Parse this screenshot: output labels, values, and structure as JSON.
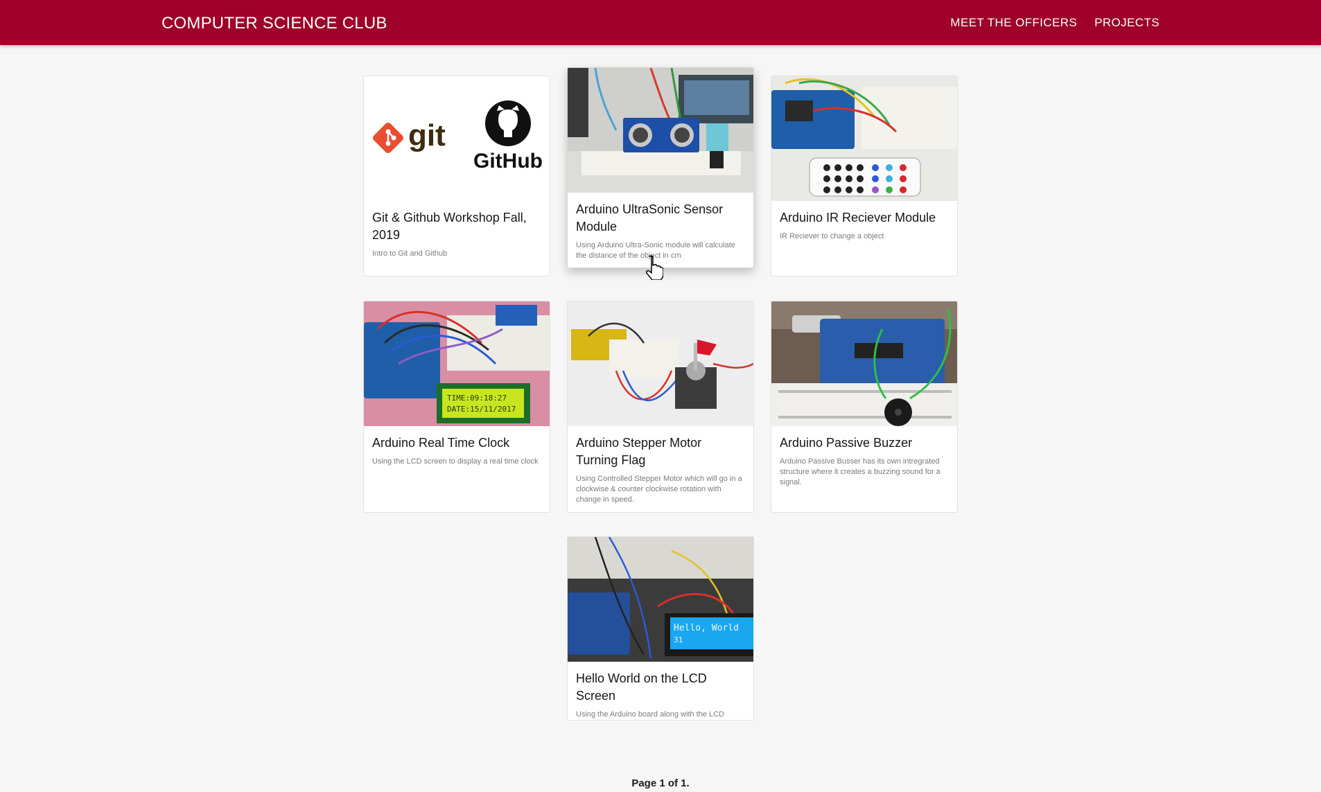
{
  "header": {
    "brand": "COMPUTER SCIENCE CLUB",
    "nav": [
      {
        "label": "MEET THE OFFICERS"
      },
      {
        "label": "PROJECTS"
      }
    ],
    "color": "#9e0029"
  },
  "projects": [
    {
      "title": "Git & Github Workshop Fall, 2019",
      "description": "Intro to Git and Github",
      "image_logos": {
        "git": "git",
        "github": "GitHub"
      }
    },
    {
      "title": "Arduino UltraSonic Sensor Module",
      "description": "Using Arduino Ultra-Sonic module will calculate the distance of the object in cm"
    },
    {
      "title": "Arduino IR Reciever Module",
      "description": "IR Reciever to change a object"
    },
    {
      "title": "Arduino Real Time Clock",
      "description": "Using the LCD screen to display a real time clock",
      "image_lcd_lines": [
        "TIME:09:18:27",
        "DATE:15/11/2017"
      ]
    },
    {
      "title": "Arduino Stepper Motor Turning Flag",
      "description": "Using Controlled Stepper Motor which will go in a clockwise & counter clockwise rotation with change in speed."
    },
    {
      "title": "Arduino Passive Buzzer",
      "description": "Arduino Passive Busser has its own intregrated structure where it creates a buzzing sound for a signal."
    },
    {
      "title": "Hello World on the LCD Screen",
      "description": "Using the Arduino board along with the LCD Screen to output the text \"Hello World\".",
      "image_lcd_lines": [
        "Hello, World",
        "31"
      ]
    }
  ],
  "pagination": {
    "text": "Page 1 of 1."
  },
  "icons": {
    "cursor": "hand-pointer-icon"
  }
}
